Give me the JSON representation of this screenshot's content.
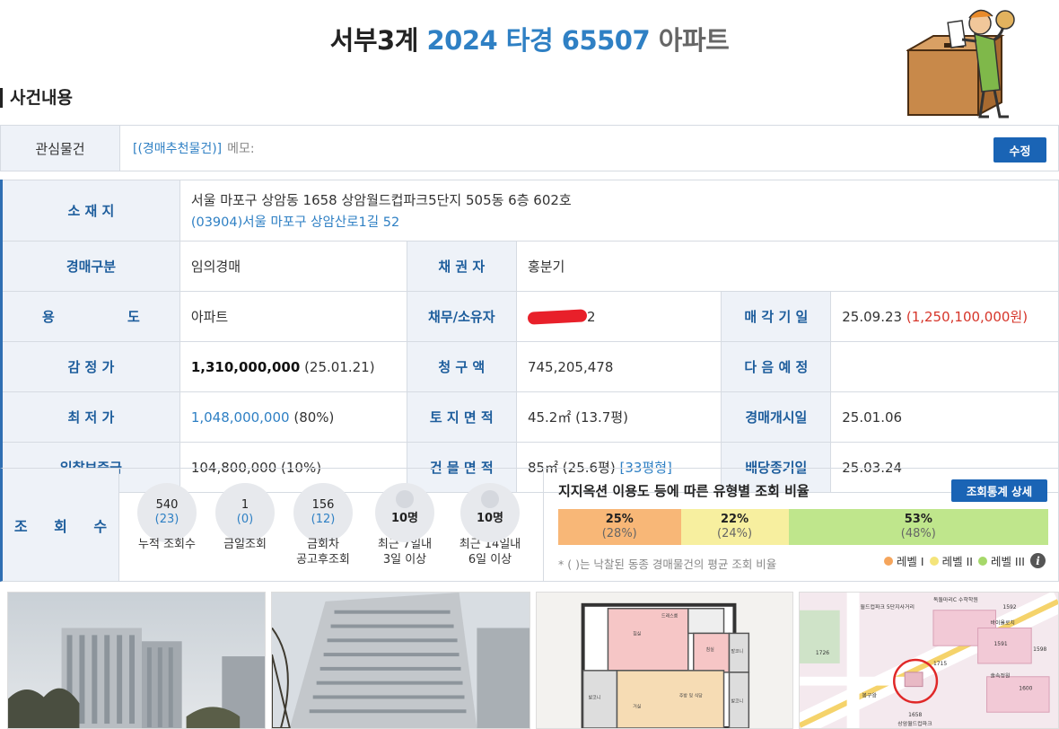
{
  "header": {
    "court": "서부3계",
    "case": "2024 타경 65507",
    "type": "아파트"
  },
  "section_title": "사건내용",
  "interest": {
    "label": "관심물건",
    "link_text": "[(경매추천물건)]",
    "memo_label": "메모:",
    "edit_button": "수정"
  },
  "info": {
    "location_label": "소 재 지",
    "address": "서울 마포구 상암동 1658 상암월드컵파크5단지 505동 6층 602호",
    "road_address": "(03904)서울 마포구 상암산로1길 52",
    "auction_type_label": "경매구분",
    "auction_type": "임의경매",
    "creditor_label": "채 권 자",
    "creditor": "홍분기",
    "use_label": "용 도",
    "use": "아파트",
    "debtor_label": "채무/소유자",
    "debtor_suffix": "2",
    "sale_date_label": "매 각 기 일",
    "sale_date": "25.09.23",
    "sale_price": "(1,250,100,000원)",
    "appraisal_label": "감 정 가",
    "appraisal": "1,310,000,000",
    "appraisal_date": "(25.01.21)",
    "claim_label": "청 구 액",
    "claim": "745,205,478",
    "next_label": "다 음 예 정",
    "next": "",
    "min_price_label": "최 저 가",
    "min_price": "1,048,000,000",
    "min_price_pct": "(80%)",
    "land_area_label": "토 지 면 적",
    "land_area": "45.2㎡ (13.7평)",
    "start_date_label": "경매개시일",
    "start_date": "25.01.06",
    "deposit_label": "입찰보증금",
    "deposit": "104,800,000 (10%)",
    "building_area_label": "건 물 면 적",
    "building_area": "85㎡ (25.6평)",
    "building_type": "[33평형]",
    "dividend_label": "배당종기일",
    "dividend_date": "25.03.24"
  },
  "views": {
    "label": "조 회 수",
    "stats": [
      {
        "num": "540",
        "paren": "(23)",
        "cap": "누적 조회수"
      },
      {
        "num": "1",
        "paren": "(0)",
        "cap": "금일조회"
      },
      {
        "num": "156",
        "paren": "(12)",
        "cap": "금회차\n공고후조회"
      },
      {
        "num": "10명",
        "cap": "최근 7일내\n3일 이상"
      },
      {
        "num": "10명",
        "cap": "최근 14일내\n6일 이상"
      }
    ],
    "ratio_title": "지지옥션 이용도 등에 따른 유형별 조회 비율",
    "detail_button": "조회통계 상세",
    "segments": [
      {
        "a": "25%",
        "b": "(28%)",
        "pct": 25,
        "color": "#f8b777"
      },
      {
        "a": "22%",
        "b": "(24%)",
        "pct": 22,
        "color": "#f7ef9f"
      },
      {
        "a": "53%",
        "b": "(48%)",
        "pct": 53,
        "color": "#bfe68c"
      }
    ],
    "note": "* ( )는 낙찰된 동종 경매물건의 평균 조회 비율",
    "legend": [
      "레벨 I",
      "레벨 II",
      "레벨 III"
    ],
    "legend_colors": [
      "#f5a55c",
      "#f4e47a",
      "#a6d86a"
    ]
  },
  "photos": {
    "floorplan_labels": [
      "드레스룸",
      "침실",
      "침실",
      "발코니",
      "거실",
      "주방 및 식당",
      "발코니",
      "발코니"
    ],
    "map_labels": [
      "월드컵파크 5단지사거리",
      "독돌마리C 수학학원",
      "1592",
      "바이올로치",
      "1591",
      "1598",
      "1600",
      "솔속정원",
      "1726",
      "1715",
      "봉구왕",
      "1658",
      "상암월드컵파크"
    ]
  }
}
